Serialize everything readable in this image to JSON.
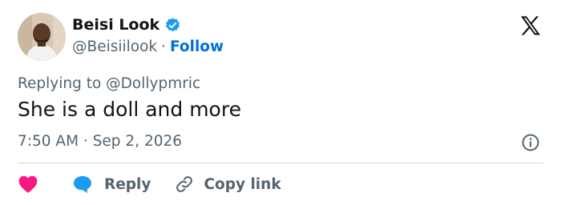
{
  "author": {
    "name": "Beisi Look",
    "handle": "@Beisiilook",
    "separator": "·",
    "follow_label": "Follow"
  },
  "tweet": {
    "replying_to": "Replying to @Dollypmric",
    "text": "She is a doll and more",
    "timestamp": "7:50 AM · Sep 2, 2026"
  },
  "actions": {
    "reply_label": "Reply",
    "copy_link_label": "Copy link"
  },
  "colors": {
    "verified": "#1d9bf0",
    "follow": "#006fd6",
    "heart": "#f91880",
    "reply_bubble": "#1d9bf0",
    "muted_text": "#536471"
  },
  "icons": [
    "verified-badge-icon",
    "x-logo-icon",
    "info-icon",
    "heart-icon",
    "speech-bubble-icon",
    "link-icon"
  ]
}
